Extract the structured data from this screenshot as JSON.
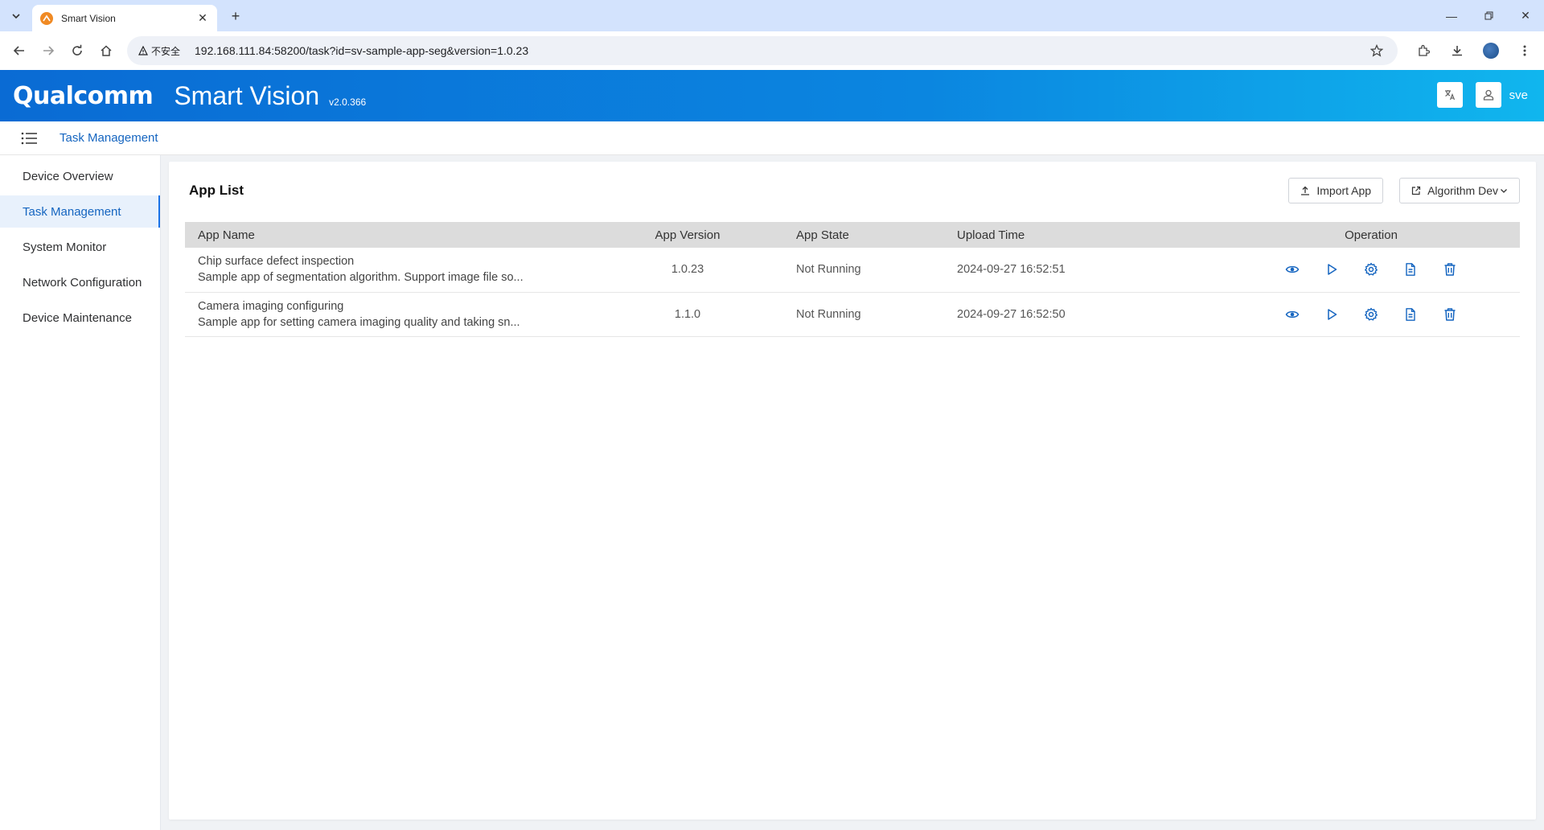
{
  "browser": {
    "tab_title": "Smart Vision",
    "security_label": "不安全",
    "url": "192.168.111.84:58200/task?id=sv-sample-app-seg&version=1.0.23"
  },
  "header": {
    "brand": "Qualcomm",
    "title": "Smart Vision",
    "version": "v2.0.366",
    "username": "sve",
    "colors": {
      "gradient_start": "#0a6bd4",
      "gradient_end": "#10b6ee"
    }
  },
  "breadcrumb": {
    "current": "Task Management"
  },
  "sidebar": {
    "items": [
      {
        "label": "Device Overview",
        "active": false
      },
      {
        "label": "Task Management",
        "active": true
      },
      {
        "label": "System Monitor",
        "active": false
      },
      {
        "label": "Network Configuration",
        "active": false
      },
      {
        "label": "Device Maintenance",
        "active": false
      }
    ]
  },
  "panel": {
    "title": "App List",
    "import_label": "Import App",
    "algo_label": "Algorithm Dev"
  },
  "table": {
    "headers": [
      "App Name",
      "App Version",
      "App State",
      "Upload Time",
      "Operation"
    ],
    "rows": [
      {
        "name": "Chip surface defect inspection",
        "desc": "Sample app of segmentation algorithm. Support image file so...",
        "version": "1.0.23",
        "state": "Not Running",
        "time": "2024-09-27 16:52:51"
      },
      {
        "name": "Camera imaging configuring",
        "desc": "Sample app for setting camera imaging quality and taking sn...",
        "version": "1.1.0",
        "state": "Not Running",
        "time": "2024-09-27 16:52:50"
      }
    ],
    "operations": [
      "view-icon",
      "play-icon",
      "settings-icon",
      "document-icon",
      "delete-icon"
    ]
  }
}
